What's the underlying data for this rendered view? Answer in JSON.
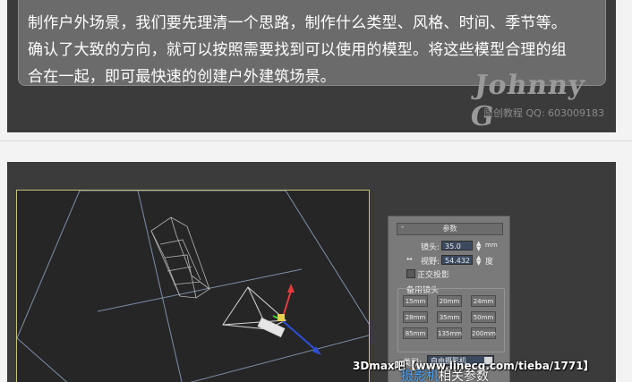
{
  "intro": {
    "lines": [
      "制作户外场景，我们要先理清一个思路，制作什么类型、风格、时间、季节等。",
      "确认了大致的方向，就可以按照需要找到可以使用的模型。将这些模型合理的组",
      "合在一起，即可最快速的创建户外建筑场景。"
    ],
    "watermark_name": "Johnny G",
    "watermark_sub": "原创教程  QQ: 603009183"
  },
  "params": {
    "title": "参数",
    "lens_label": "镜头:",
    "lens_value": "35.0",
    "lens_unit": "mm",
    "fov_label": "视野:",
    "fov_value": "54.432",
    "fov_unit": "度",
    "ortho_label": "正交投影",
    "stock_label": "备用镜头",
    "stock_lenses": [
      "15mm",
      "20mm",
      "24mm",
      "28mm",
      "35mm",
      "50mm",
      "85mm",
      "135mm",
      "200mm"
    ],
    "type_label": "类型:",
    "type_value": "自由摄影机"
  },
  "overlay": {
    "site_watermark": "3Dmax吧【www.linecg.com/tieba/1771】",
    "caption_highlight": "摄影机",
    "caption_rest": "相关参数"
  },
  "colors": {
    "panel_bg": "#3b3b3b",
    "viewport_border": "#c8c27a",
    "caption_highlight": "#4aa8ff"
  }
}
